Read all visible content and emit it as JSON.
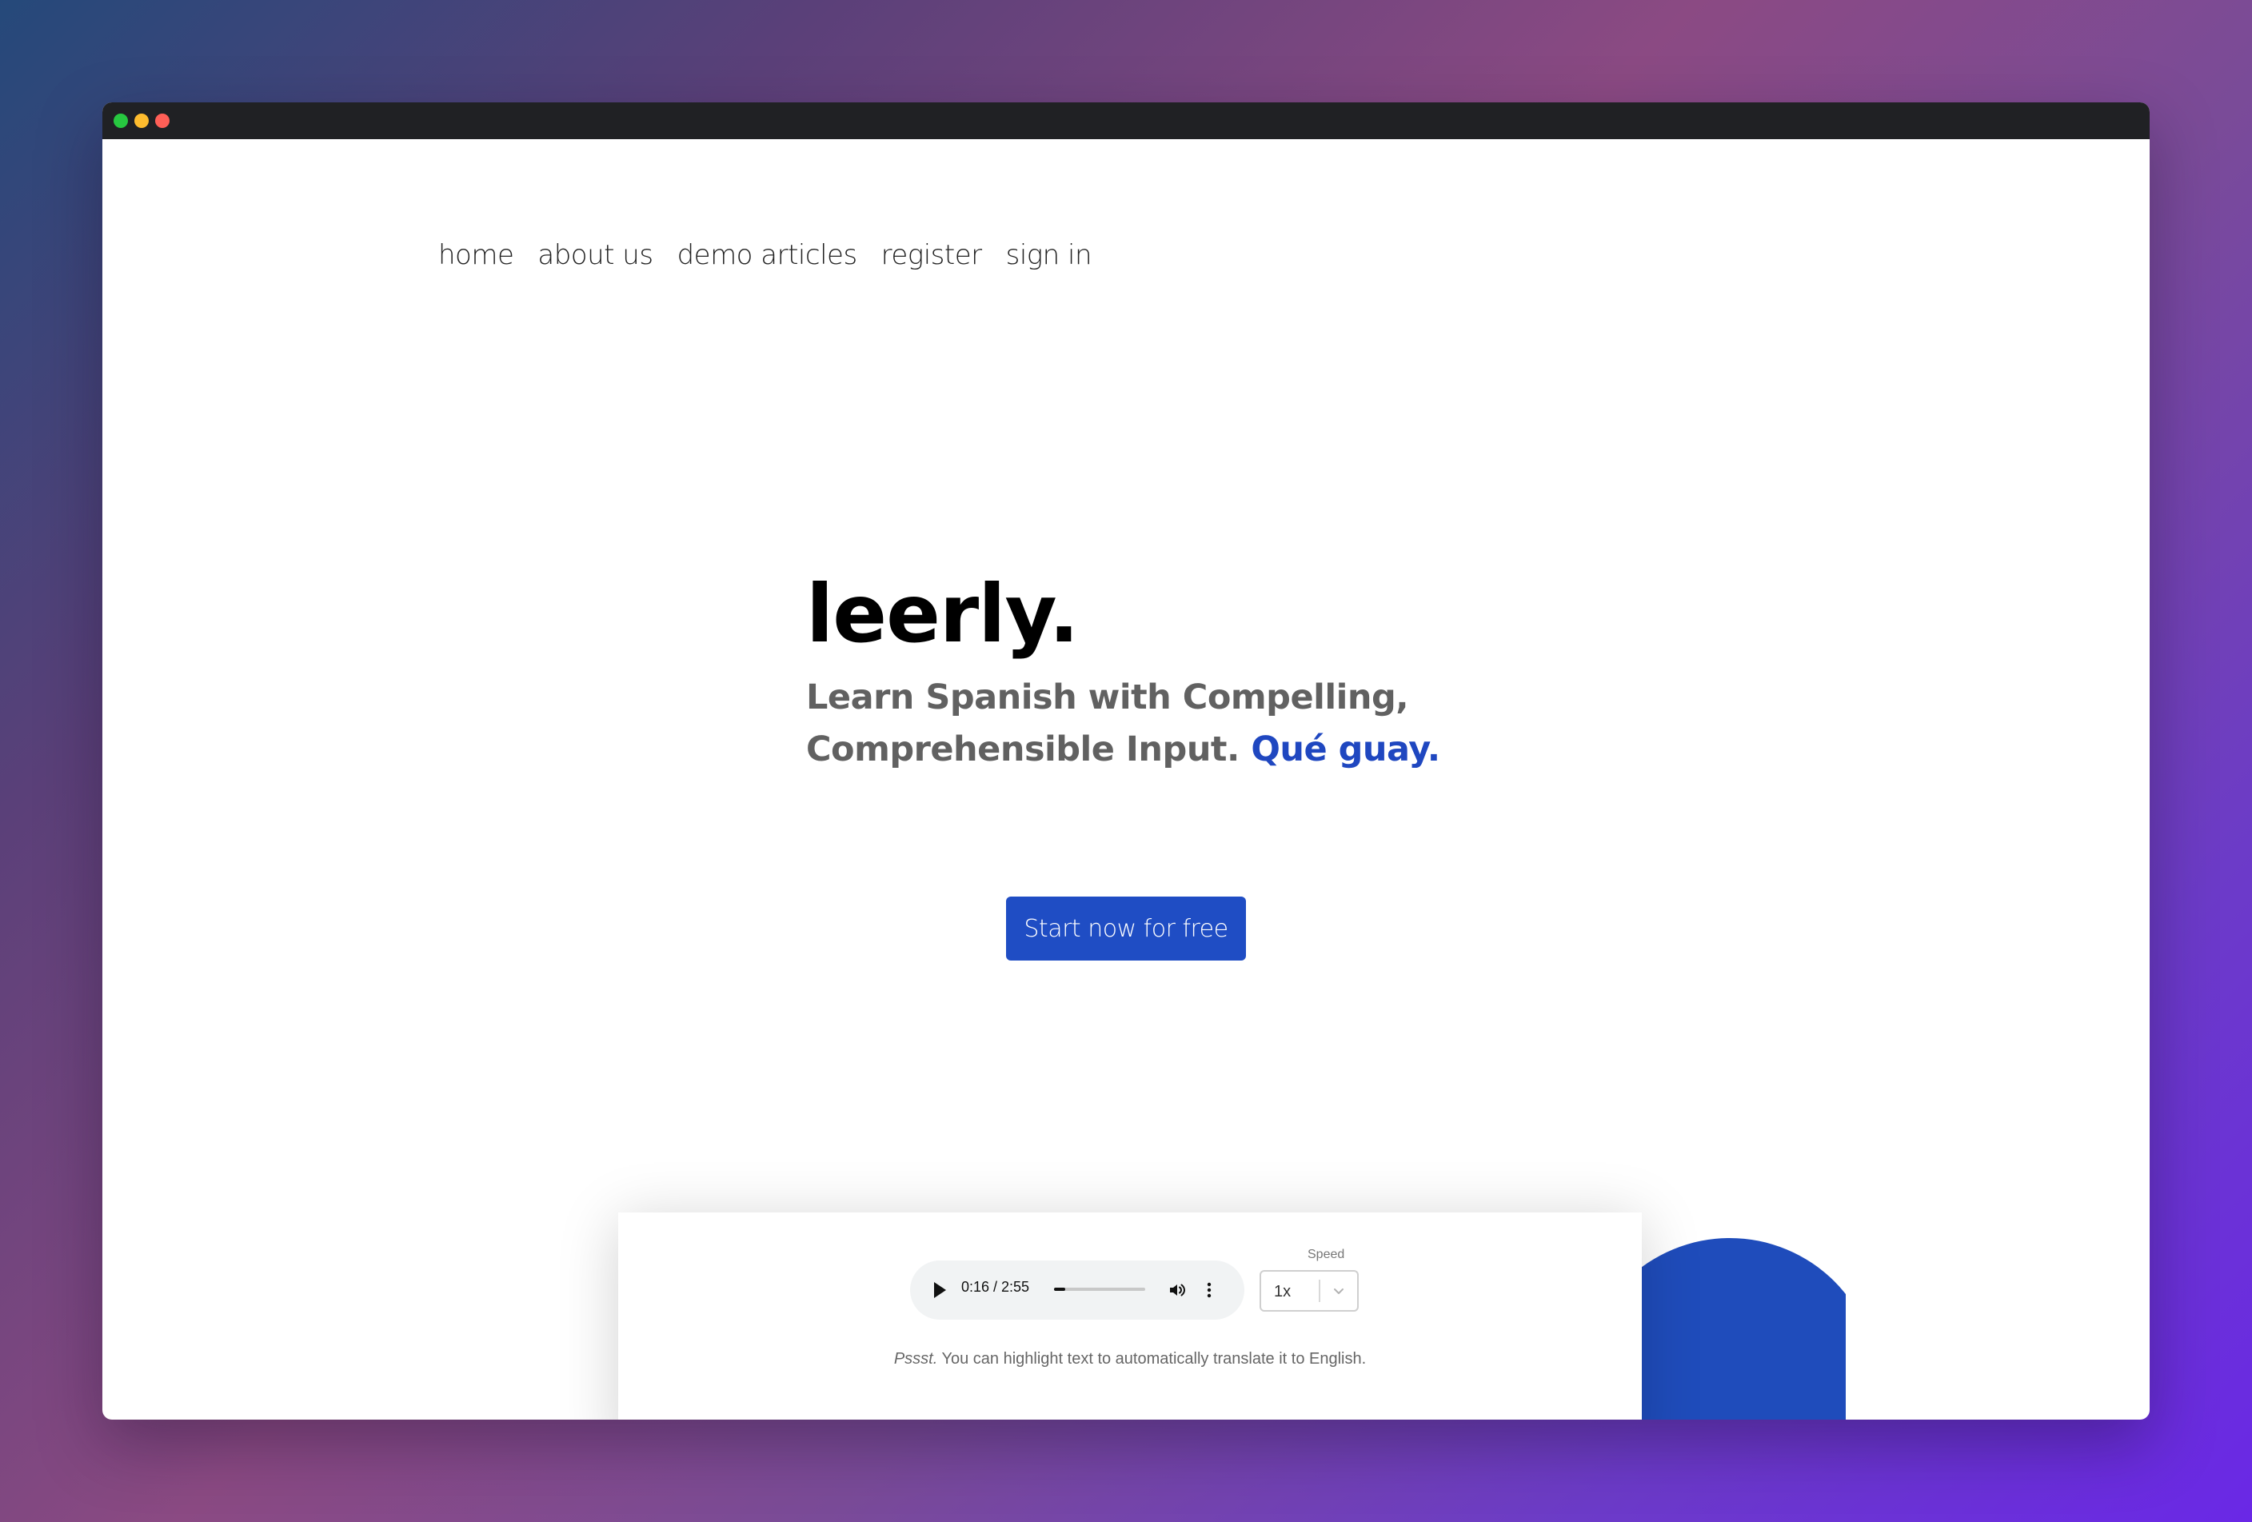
{
  "window": {
    "controls": [
      "green-dot",
      "yellow-dot",
      "red-dot"
    ]
  },
  "nav": {
    "items": [
      {
        "label": "home"
      },
      {
        "label": "about us"
      },
      {
        "label": "demo articles"
      },
      {
        "label": "register"
      },
      {
        "label": "sign in"
      }
    ]
  },
  "hero": {
    "logo": "leerly.",
    "tagline_line1": "Learn Spanish with Compelling,",
    "tagline_line2": "Comprehensible Input.",
    "tagline_accent": "Qué guay.",
    "cta_label": "Start now for free"
  },
  "preview": {
    "audio": {
      "time_display": "0:16 / 2:55",
      "progress_fraction": 0.12
    },
    "speed": {
      "label": "Speed",
      "value": "1x"
    },
    "hint_prefix": "Pssst.",
    "hint_text": " You can highlight text to automatically translate it to English."
  },
  "colors": {
    "accent_blue": "#1f4dc4",
    "orange": "#f5840c",
    "titlebar": "#202124"
  }
}
